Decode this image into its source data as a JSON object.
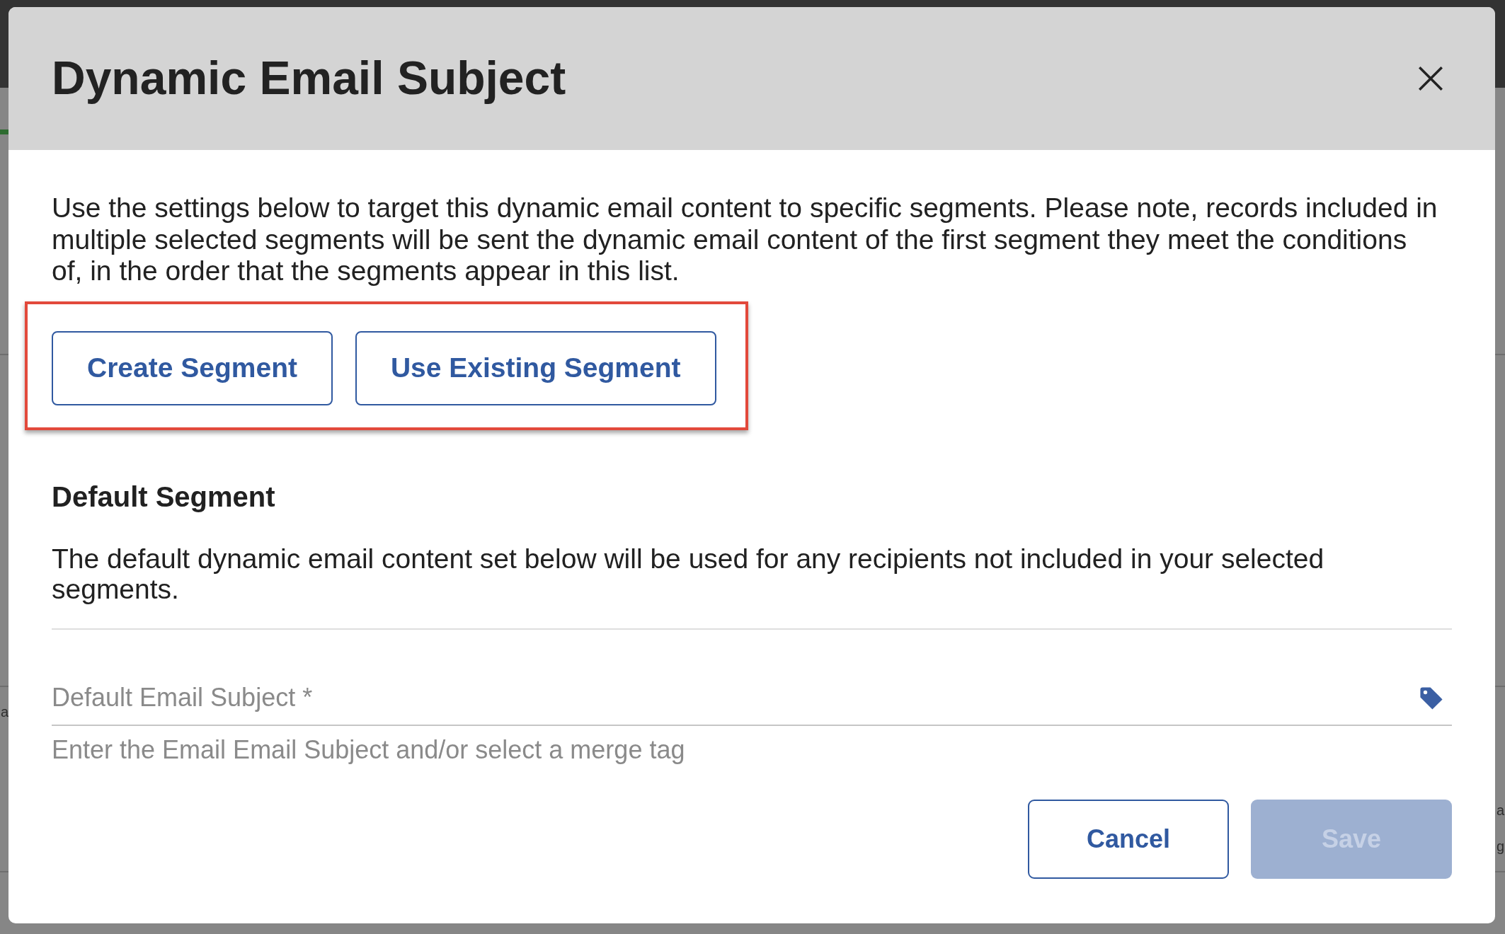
{
  "backdrop": {
    "left_edge_text": [
      "a"
    ],
    "right_edge_text": [
      "a",
      "g"
    ]
  },
  "dialog": {
    "title": "Dynamic Email Subject"
  },
  "intro": "Use the settings below to target this dynamic email content to specific segments. Please note, records included in multiple selected segments will be sent the dynamic email content of the first segment they meet the conditions of, in the order that the segments appear in this list.",
  "segment_actions": {
    "highlighted": true,
    "buttons": [
      {
        "label": "Create Segment"
      },
      {
        "label": "Use Existing Segment"
      }
    ]
  },
  "default_segment": {
    "heading": "Default Segment",
    "description": "The default dynamic email content set below will be used for any recipients not included in your selected segments.",
    "subject_field": {
      "placeholder": "Default Email Subject *",
      "helper": "Enter the Email Email Subject and/or select a merge tag"
    }
  },
  "footer_buttons": [
    {
      "label": "Cancel",
      "kind": "outline",
      "disabled": false
    },
    {
      "label": "Save",
      "kind": "filled",
      "disabled": true
    }
  ]
}
